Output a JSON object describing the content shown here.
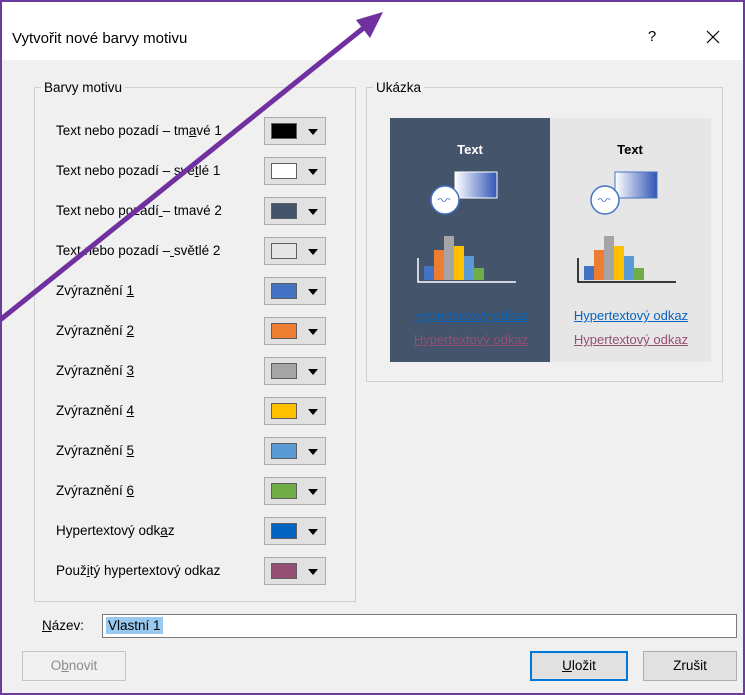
{
  "dialog": {
    "title": "Vytvořit nové barvy motivu",
    "help_label": "?"
  },
  "theme_colors": {
    "legend": "Barvy motivu",
    "rows": [
      {
        "label": "Text nebo pozadí – tmavé 1",
        "color": "#000000"
      },
      {
        "label": "Text nebo pozadí – světlé 1",
        "color": "#ffffff"
      },
      {
        "label": "Text nebo pozadí – tmavé 2",
        "color": "#44546a"
      },
      {
        "label": "Text nebo pozadí – světlé 2",
        "color": "#e7e6e6"
      },
      {
        "label": "Zvýraznění 1",
        "color": "#4472c4"
      },
      {
        "label": "Zvýraznění 2",
        "color": "#ed7d31"
      },
      {
        "label": "Zvýraznění 3",
        "color": "#a5a5a5"
      },
      {
        "label": "Zvýraznění 4",
        "color": "#ffc000"
      },
      {
        "label": "Zvýraznění 5",
        "color": "#5b9bd5"
      },
      {
        "label": "Zvýraznění 6",
        "color": "#70ad47"
      },
      {
        "label": "Hypertextový odkaz",
        "color": "#0563c1"
      },
      {
        "label": "Použitý hypertextový odkaz",
        "color": "#954f72"
      }
    ]
  },
  "preview": {
    "legend": "Ukázka",
    "sample_text": "Text",
    "link_text": "Hypertextový odkaz",
    "visited_link_text": "Hypertextový odkaz"
  },
  "name_field": {
    "label": "Název:",
    "value": "Vlastní 1"
  },
  "buttons": {
    "reset": "Obnovit",
    "save": "Uložit",
    "cancel": "Zrušit"
  },
  "annotation": {
    "arrow_color": "#7030a0"
  }
}
